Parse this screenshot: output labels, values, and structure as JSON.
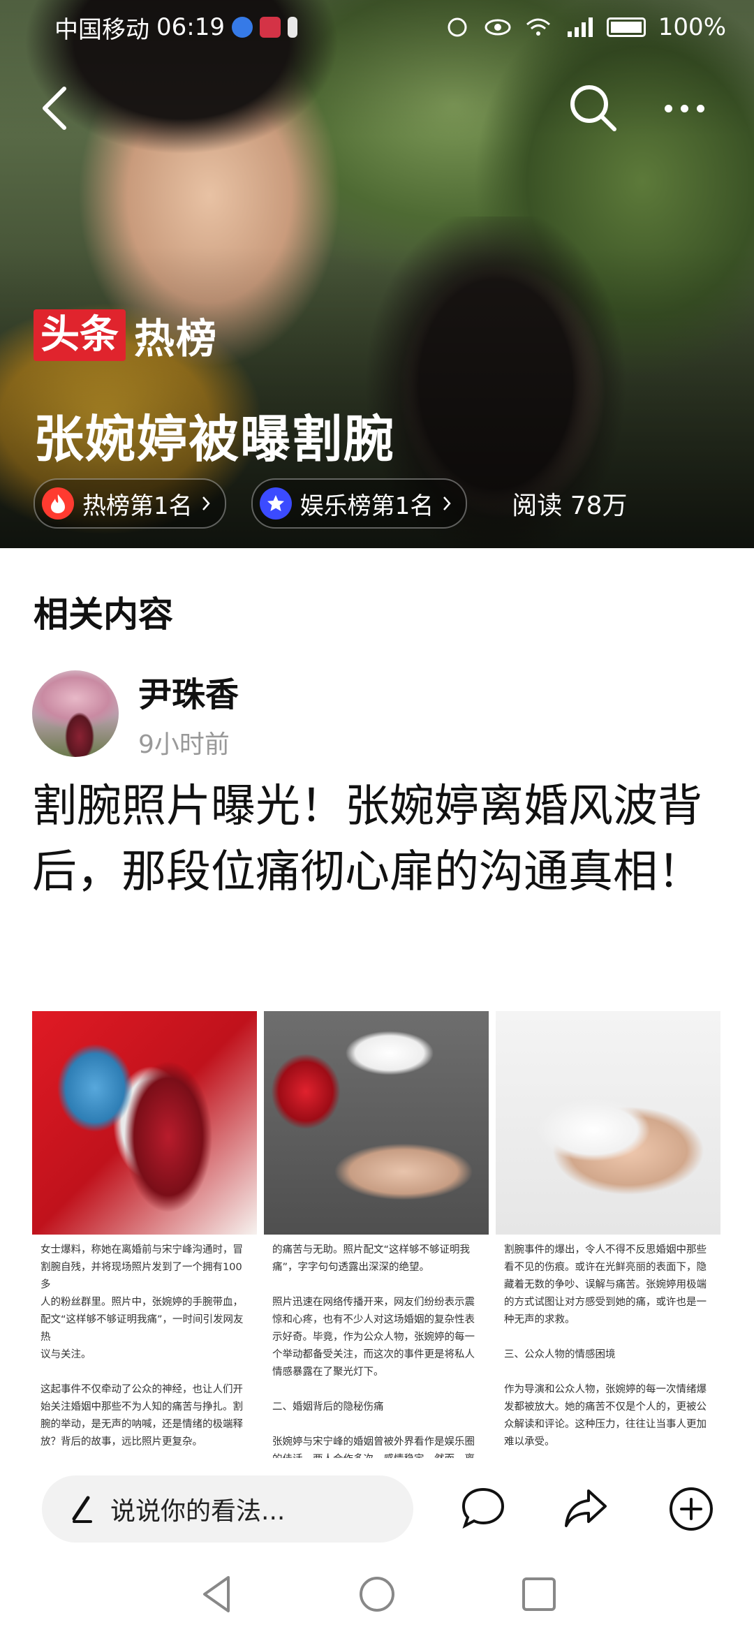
{
  "status_bar": {
    "carrier": "中国移动",
    "time": "06:19",
    "battery": "100%"
  },
  "hero": {
    "brand_part1": "头条",
    "brand_part2": "热榜",
    "topic_title": "张婉婷被曝割腕",
    "hot_rank_label": "热榜第1名",
    "ent_rank_label": "娱乐榜第1名",
    "read_count": "阅读 78万"
  },
  "related": {
    "section_title": "相关内容",
    "author_name": "尹珠香",
    "post_time": "9小时前",
    "headline": "割腕照片曝光！张婉婷离婚风波背后，那段位痛彻心扉的沟通真相！",
    "thumb_texts": [
      "女士爆料，称她在离婚前与宋宁峰沟通时，冒\n割腕自残，并将现场照片发到了一个拥有100多\n人的粉丝群里。照片中，张婉婷的手腕带血，\n配文“这样够不够证明我痛”，一时间引发网友热\n议与关注。\n\n这起事件不仅牵动了公众的神经，也让人们开\n始关注婚姻中那些不为人知的痛苦与挣扎。割\n腕的举动，是无声的呐喊，还是情绪的极端释\n放？背后的故事，远比照片更复杂。\n\n一、事件回顾：割腕照片曝光引发轩然大波\n\n据Q女士爆料，张婉婷在与宋宁峰沟通离婚事",
      "的痛苦与无助。照片配文“这样够不够证明我\n痛”，字字句句透露出深深的绝望。\n\n照片迅速在网络传播开来，网友们纷纷表示震\n惊和心疼，也有不少人对这场婚姻的复杂性表\n示好奇。毕竟，作为公众人物，张婉婷的每一\n个举动都备受关注，而这次的事件更是将私人\n情感暴露在了聚光灯下。\n\n二、婚姻背后的隐秘伤痛\n\n张婉婷与宋宁峰的婚姻曾被外界看作是娱乐圈\n的佳话，两人合作多次，感情稳定。然而，离\n婚的消息一出，粉丝们才意识到这段婚姻并非",
      "割腕事件的爆出，令人不得不反思婚姻中那些\n看不见的伤痕。或许在光鲜亮丽的表面下，隐\n藏着无数的争吵、误解与痛苦。张婉婷用极端\n的方式试图让对方感受到她的痛，或许也是一\n种无声的求救。\n\n三、公众人物的情感困境\n\n作为导演和公众人物，张婉婷的每一次情绪爆\n发都被放大。她的痛苦不仅是个人的，更被公\n众解读和评论。这种压力，往往让当事人更加\n难以承受。\n\n在社交媒体高度发达的今天，私人情感的曝光"
    ]
  },
  "bottom_bar": {
    "comment_placeholder": "说说你的看法..."
  },
  "icons": {
    "back": "back-arrow-icon",
    "search": "search-icon",
    "more": "more-dots-icon",
    "fire": "fire-icon",
    "star": "star-icon",
    "pen": "pen-icon",
    "comment": "comment-bubble-icon",
    "share": "share-arrow-icon",
    "add": "plus-circle-icon"
  },
  "colors": {
    "brand_red": "#e0242d",
    "fire_red": "#ff3b30",
    "star_blue": "#3b4bff"
  }
}
